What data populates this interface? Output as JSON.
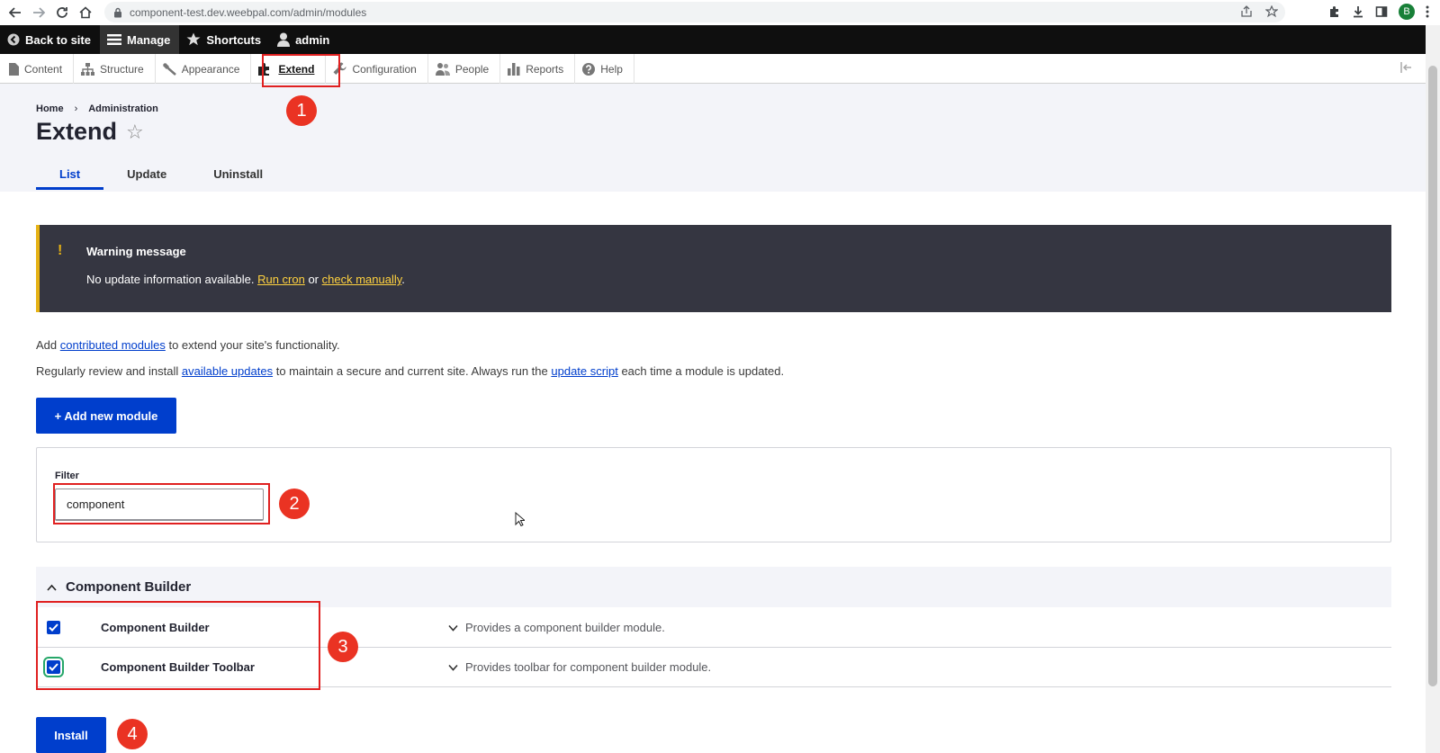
{
  "browser": {
    "url": "component-test.dev.weebpal.com/admin/modules",
    "profile_initial": "B"
  },
  "toolbar": {
    "back_to_site": "Back to site",
    "manage": "Manage",
    "shortcuts": "Shortcuts",
    "user": "admin"
  },
  "tray": {
    "items": [
      {
        "label": "Content",
        "icon": "document-icon"
      },
      {
        "label": "Structure",
        "icon": "sitemap-icon"
      },
      {
        "label": "Appearance",
        "icon": "paintbrush-icon"
      },
      {
        "label": "Extend",
        "icon": "puzzle-icon"
      },
      {
        "label": "Configuration",
        "icon": "wrench-icon"
      },
      {
        "label": "People",
        "icon": "people-icon"
      },
      {
        "label": "Reports",
        "icon": "bar-chart-icon"
      },
      {
        "label": "Help",
        "icon": "help-icon"
      }
    ]
  },
  "breadcrumb": {
    "home": "Home",
    "sep": "›",
    "admin": "Administration"
  },
  "page": {
    "title": "Extend",
    "tabs": [
      "List",
      "Update",
      "Uninstall"
    ]
  },
  "warning": {
    "title": "Warning message",
    "text": "No update information available.",
    "link1": "Run cron",
    "or": "or",
    "link2": "check manually",
    "period": "."
  },
  "intro": {
    "line1_pre": "Add",
    "line1_link": "contributed modules",
    "line1_post": "to extend your site's functionality.",
    "line2_pre": "Regularly review and install",
    "line2_link1": "available updates",
    "line2_mid": "to maintain a secure and current site. Always run the",
    "line2_link2": "update script",
    "line2_post": "each time a module is updated."
  },
  "add_module_button": "+ Add new module",
  "filter": {
    "label": "Filter",
    "value": "component"
  },
  "group": {
    "title": "Component Builder"
  },
  "modules": [
    {
      "name": "Component Builder",
      "description": "Provides a component builder module.",
      "checked": true
    },
    {
      "name": "Component Builder Toolbar",
      "description": "Provides toolbar for component builder module.",
      "checked": true
    }
  ],
  "install_button": "Install",
  "annotations": [
    "1",
    "2",
    "3",
    "4"
  ],
  "colors": {
    "accent": "#003ecc",
    "annotation": "#ea3323",
    "warning_bg": "#353641",
    "warning_accent": "#e6b214"
  }
}
